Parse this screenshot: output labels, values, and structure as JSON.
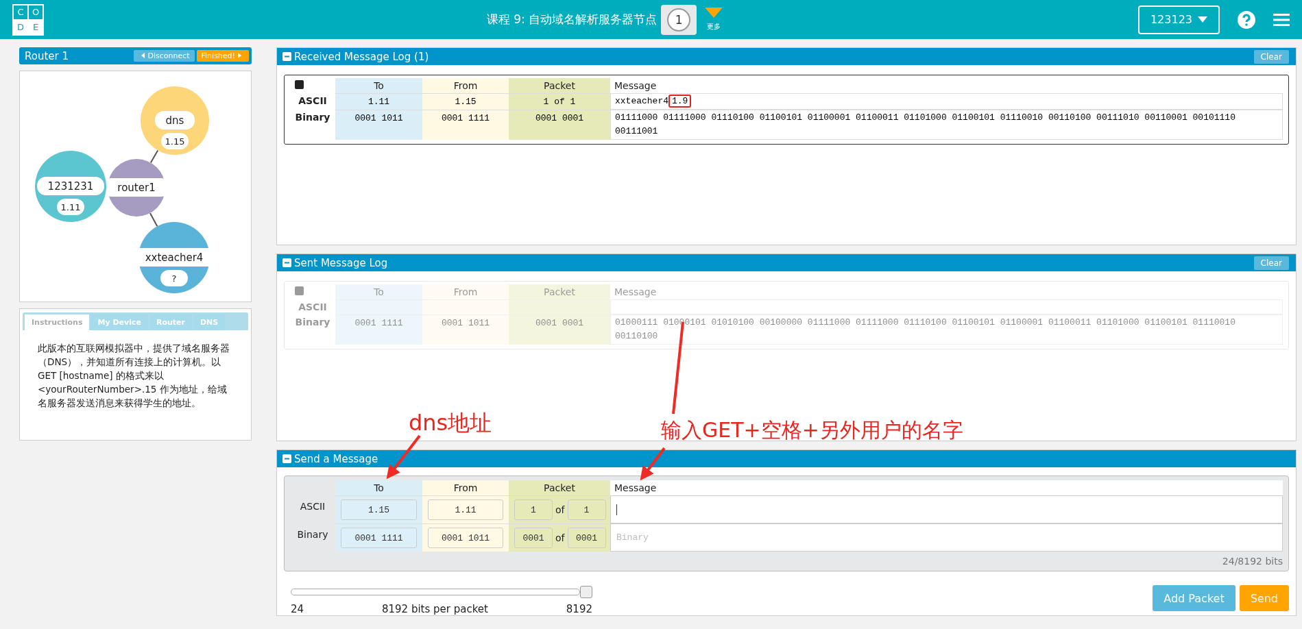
{
  "header": {
    "logo_letters": [
      "C",
      "O",
      "D",
      "E"
    ],
    "lesson_title": "课程 9: 自动域名解析服务器节点",
    "level_bubble": "1",
    "more_label": "更多",
    "user_menu": "123123"
  },
  "router_panel": {
    "title": "Router 1",
    "disconnect_button": "Disconnect",
    "finished_button": "Finished!",
    "nodes": [
      {
        "name": "dns",
        "address": "1.15",
        "color": "#fdd679",
        "kind": "peer"
      },
      {
        "name": "router1",
        "color": "#a69bc1",
        "kind": "router"
      },
      {
        "name": "1231231",
        "address": "1.11",
        "color": "#5bc5d0",
        "kind": "peer"
      },
      {
        "name": "xxteacher4",
        "address": "?",
        "color": "#5ab4da",
        "kind": "peer"
      }
    ]
  },
  "info_tabs": [
    {
      "label": "Instructions",
      "selected": true
    },
    {
      "label": "My Device",
      "selected": false
    },
    {
      "label": "Router",
      "selected": false
    },
    {
      "label": "DNS",
      "selected": false
    }
  ],
  "instructions": "此版本的互联网模拟器中，提供了域名服务器（DNS），并知道所有连接上的计算机。以 GET [hostname] 的格式来以 <yourRouterNumber>.15 作为地址，给域名服务器发送消息来获得学生的地址。",
  "received_log": {
    "title": "Received Message Log (1)",
    "clear_button": "Clear",
    "columns": [
      "To",
      "From",
      "Packet",
      "Message"
    ],
    "rows": [
      {
        "label": "ASCII",
        "to": "1.11",
        "from": "1.15",
        "packet": "1 of 1",
        "message": "xxteacher4",
        "message_highlight": "1.9"
      },
      {
        "label": "Binary",
        "to": "0001 1011",
        "from": "0001 1111",
        "packet": "0001 0001",
        "message": "01111000 01111000 01110100 01100101 01100001 01100011 01101000 01100101 01110010 00110100 00111010 00110001 00101110 00111001"
      }
    ]
  },
  "sent_log": {
    "title": "Sent Message Log",
    "clear_button": "Clear",
    "columns": [
      "To",
      "From",
      "Packet",
      "Message"
    ],
    "rows": [
      {
        "label": "ASCII"
      },
      {
        "label": "Binary",
        "to": "0001 1111",
        "from": "0001 1011",
        "packet": "0001 0001",
        "message": "01000111 01000101 01010100 00100000 01111000 01111000 01110100 01100101 01100001 01100011 01101000 01100101 01110010 00110100"
      }
    ]
  },
  "send_message": {
    "title": "Send a Message",
    "columns": [
      "To",
      "From",
      "Packet",
      "Message"
    ],
    "ascii": {
      "label": "ASCII",
      "to": "1.15",
      "from": "1.11",
      "packet_index": "1",
      "of_label": "of",
      "packet_count": "1"
    },
    "binary": {
      "label": "Binary",
      "to": "0001 1111",
      "from": "0001 1011",
      "packet_index": "0001",
      "of_label": "of",
      "packet_count": "0001",
      "message_placeholder": "Binary"
    },
    "bit_count": "24/8192 bits",
    "slider": {
      "level": 1,
      "min_label": "24",
      "caption": "8192 bits per packet",
      "max_label": "8192"
    },
    "add_packet_button": "Add Packet",
    "send_button": "Send"
  },
  "annotations": [
    {
      "text": "dns地址"
    },
    {
      "text": "输入GET+空格+另外用户的名字"
    }
  ]
}
